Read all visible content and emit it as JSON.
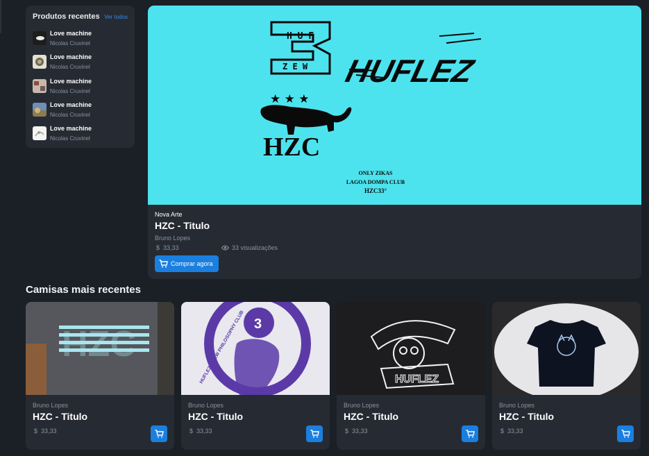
{
  "recent": {
    "title": "Produtos recentes",
    "see_all": "Ver todos",
    "items": [
      {
        "title": "Love machine",
        "author": "Nicolas Cruvinel"
      },
      {
        "title": "Love machine",
        "author": "Nicolas Cruvinel"
      },
      {
        "title": "Love machine",
        "author": "Nicolas Cruvinel"
      },
      {
        "title": "Love machine",
        "author": "Nicolas Cruvinel"
      },
      {
        "title": "Love machine",
        "author": "Nicolas Cruvinel"
      }
    ]
  },
  "hero": {
    "logo_letters": "HUFLEZ",
    "logo_number": "33",
    "wordmark": "HUFLEZ",
    "hzc": "HZC",
    "stars": "★ ★ ★",
    "tag_lines": [
      "ONLY ZIKAS",
      "LAGOA DOMPA CLUB",
      "HZC33°"
    ],
    "kicker": "Nova Arte",
    "title": "HZC - Titulo",
    "author": "Bruno Lopes",
    "currency": "$",
    "price": "33,33",
    "views": "33 visualizações",
    "buy_label": "Comprar agora"
  },
  "section_title": "Camisas mais recentes",
  "cards": [
    {
      "author": "Bruno Lopes",
      "title": "HZC - Titulo",
      "currency": "$",
      "price": "33,33",
      "shirt_text": "HZC"
    },
    {
      "author": "Bruno Lopes",
      "title": "HZC - Titulo",
      "currency": "$",
      "price": "33,33",
      "shirt_text": "HUFLEZ CREW PHILOSOPHY CLUB"
    },
    {
      "author": "Bruno Lopes",
      "title": "HZC - Titulo",
      "currency": "$",
      "price": "33,33",
      "shirt_text": "HUFLEZ"
    },
    {
      "author": "Bruno Lopes",
      "title": "HZC - Titulo",
      "currency": "$",
      "price": "33,33",
      "shirt_text": ""
    }
  ],
  "colors": {
    "accent": "#1b7fe0",
    "hero_bg": "#4de3ee",
    "panel": "#262b33",
    "page": "#1b1f26"
  }
}
